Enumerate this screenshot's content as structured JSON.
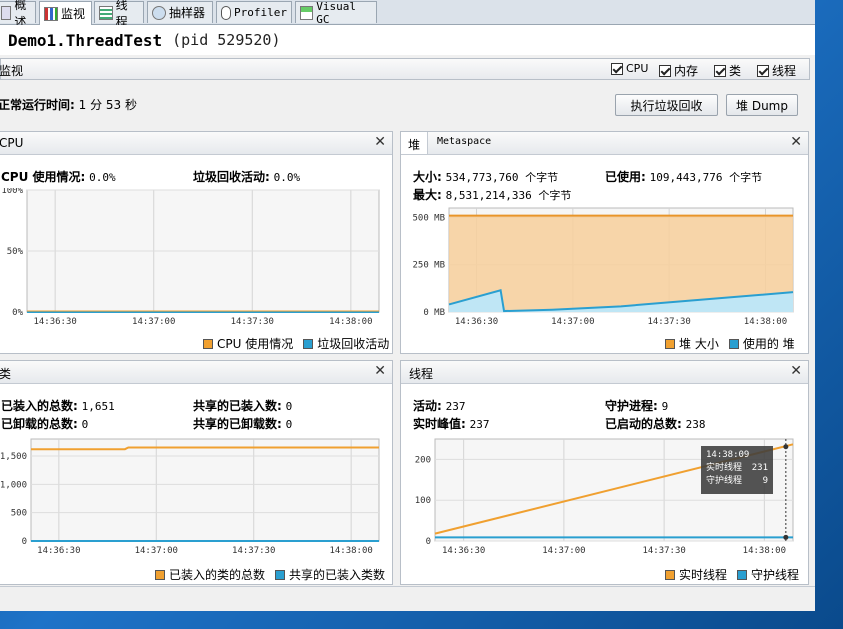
{
  "tabs": [
    {
      "label": "概述",
      "icon": "overview-icon"
    },
    {
      "label": "监视",
      "icon": "monitor-icon"
    },
    {
      "label": "线程",
      "icon": "threads-icon"
    },
    {
      "label": "抽样器",
      "icon": "sampler-icon"
    },
    {
      "label": "Profiler",
      "icon": "profiler-icon"
    },
    {
      "label": "Visual GC",
      "icon": "visual-gc-icon"
    }
  ],
  "header": {
    "app_name": "Demo1.ThreadTest",
    "pid": "(pid 529520)"
  },
  "monitor": {
    "title": "监视",
    "checkboxes": [
      {
        "label": "CPU",
        "checked": true
      },
      {
        "label": "内存",
        "checked": true
      },
      {
        "label": "类",
        "checked": true
      },
      {
        "label": "线程",
        "checked": true
      }
    ],
    "uptime_label": "正常运行时间:",
    "uptime_value": "1 分 53 秒",
    "gc_button": "执行垃圾回收",
    "heap_dump_button": "堆 Dump"
  },
  "cpu_panel": {
    "title": "CPU",
    "usage_label": "CPU 使用情况:",
    "usage_value": "0.0%",
    "gc_label": "垃圾回收活动:",
    "gc_value": "0.0%",
    "legend": [
      "CPU 使用情况",
      "垃圾回收活动"
    ]
  },
  "heap_panel": {
    "tab_heap": "堆",
    "tab_metaspace": "Metaspace",
    "size_label": "大小:",
    "size_value": "534,773,760 个字节",
    "max_label": "最大:",
    "max_value": "8,531,214,336 个字节",
    "used_label": "已使用:",
    "used_value": "109,443,776 个字节",
    "legend": [
      "堆 大小",
      "使用的 堆"
    ]
  },
  "classes_panel": {
    "title": "类",
    "loaded_label": "已装入的总数:",
    "loaded_value": "1,651",
    "unloaded_label": "已卸载的总数:",
    "unloaded_value": "0",
    "shared_loaded_label": "共享的已装入数:",
    "shared_loaded_value": "0",
    "shared_unloaded_label": "共享的已卸载数:",
    "shared_unloaded_value": "0",
    "legend": [
      "已装入的类的总数",
      "共享的已装入类数"
    ]
  },
  "threads_panel": {
    "title": "线程",
    "live_label": "活动:",
    "live_value": "237",
    "peak_label": "实时峰值:",
    "peak_value": "237",
    "daemon_label": "守护进程:",
    "daemon_value": "9",
    "started_label": "已启动的总数:",
    "started_value": "238",
    "tooltip": {
      "time": "14:38:09",
      "rows": [
        {
          "label": "实时线程",
          "value": "231"
        },
        {
          "label": "守护线程",
          "value": "9"
        }
      ]
    },
    "legend": [
      "实时线程",
      "守护线程"
    ]
  },
  "colors": {
    "orange": "#f0a030",
    "blue": "#2a9fd0"
  },
  "chart_data": [
    {
      "type": "line",
      "id": "cpu",
      "xticks": [
        "14:36:30",
        "14:37:00",
        "14:37:30",
        "14:38:00"
      ],
      "yticks": [
        "100%",
        "50%",
        "0%"
      ],
      "ylim": [
        0,
        100
      ],
      "grid": true,
      "series": [
        {
          "name": "CPU 使用情况",
          "values": [
            0,
            0
          ]
        },
        {
          "name": "垃圾回收活动",
          "values": [
            0,
            0
          ]
        }
      ]
    },
    {
      "type": "area",
      "id": "heap",
      "xticks": [
        "14:36:30",
        "14:37:00",
        "14:37:30",
        "14:38:00"
      ],
      "yticks": [
        "500 MB",
        "250 MB",
        "0 MB"
      ],
      "ylim": [
        0,
        550
      ],
      "grid": true,
      "series": [
        {
          "name": "堆 大小",
          "points": [
            [
              0,
              510
            ],
            [
              1,
              510
            ]
          ]
        },
        {
          "name": "使用的 堆",
          "points": [
            [
              0,
              40
            ],
            [
              0.15,
              115
            ],
            [
              0.16,
              5
            ],
            [
              0.3,
              12
            ],
            [
              0.5,
              30
            ],
            [
              0.7,
              60
            ],
            [
              1,
              105
            ]
          ]
        }
      ]
    },
    {
      "type": "line",
      "id": "classes",
      "xticks": [
        "14:36:30",
        "14:37:00",
        "14:37:30",
        "14:38:00"
      ],
      "yticks": [
        "1,500",
        "1,000",
        "500",
        "0"
      ],
      "ylim": [
        0,
        1800
      ],
      "grid": true,
      "series": [
        {
          "name": "已装入的类的总数",
          "points": [
            [
              0,
              1620
            ],
            [
              0.27,
              1620
            ],
            [
              0.28,
              1651
            ],
            [
              1,
              1651
            ]
          ]
        },
        {
          "name": "共享的已装入类数",
          "points": [
            [
              0,
              0
            ],
            [
              1,
              0
            ]
          ]
        }
      ]
    },
    {
      "type": "line",
      "id": "threads",
      "xticks": [
        "14:36:30",
        "14:37:00",
        "14:37:30",
        "14:38:00"
      ],
      "yticks": [
        "200",
        "100",
        "0"
      ],
      "ylim": [
        0,
        250
      ],
      "grid": true,
      "series": [
        {
          "name": "实时线程",
          "points": [
            [
              0,
              18
            ],
            [
              1,
              237
            ]
          ]
        },
        {
          "name": "守护线程",
          "points": [
            [
              0,
              9
            ],
            [
              1,
              9
            ]
          ]
        }
      ]
    }
  ]
}
